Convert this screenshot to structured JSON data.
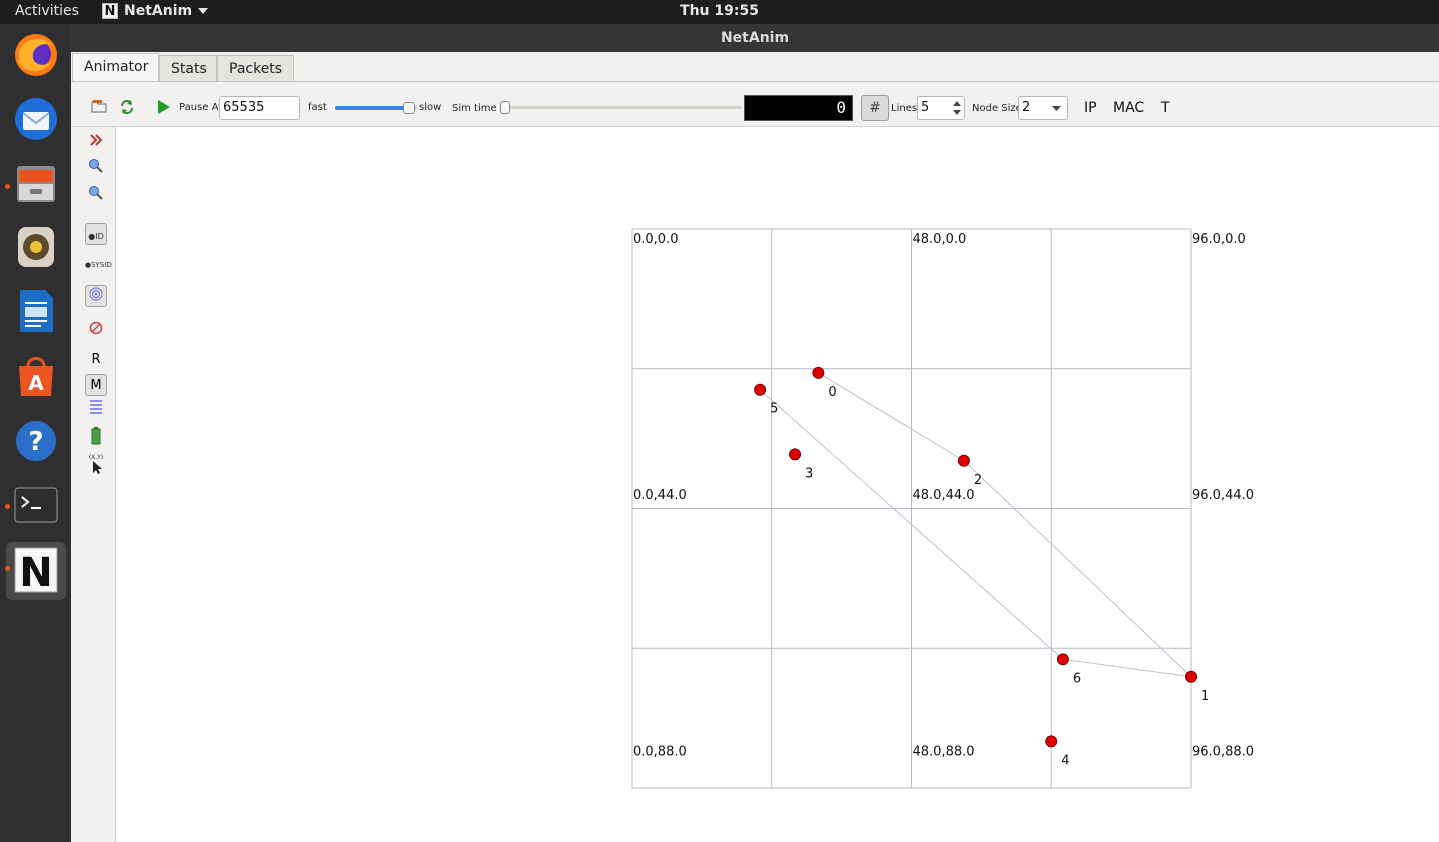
{
  "topbar": {
    "activities_label": "Activities",
    "app_menu_logo": "N",
    "app_menu_label": "NetAnim",
    "app_menu_icon": "chevron-down-icon",
    "clock": "Thu 19:55"
  },
  "dock": {
    "items": [
      {
        "name": "Firefox",
        "icon": "firefox-icon",
        "running": false
      },
      {
        "name": "Thunderbird",
        "icon": "thunderbird-icon",
        "running": false
      },
      {
        "name": "Files",
        "icon": "files-icon",
        "running": true
      },
      {
        "name": "Rhythmbox",
        "icon": "rhythmbox-icon",
        "running": false
      },
      {
        "name": "LibreOffice Writer",
        "icon": "writer-icon",
        "running": false
      },
      {
        "name": "Ubuntu Software",
        "icon": "software-icon",
        "running": false
      },
      {
        "name": "Help",
        "icon": "help-icon",
        "running": false
      },
      {
        "name": "Terminal",
        "icon": "terminal-icon",
        "running": true
      },
      {
        "name": "NetAnim",
        "icon": "netanim-icon",
        "running": true,
        "label": "N"
      }
    ]
  },
  "window": {
    "title": "NetAnim"
  },
  "tabs": [
    {
      "label": "Animator",
      "active": true
    },
    {
      "label": "Stats",
      "active": false
    },
    {
      "label": "Packets",
      "active": false
    }
  ],
  "toolbar": {
    "pause_at_label": "Pause At",
    "pause_at_value": "65535",
    "fast_label": "fast",
    "slow_label": "slow",
    "speed_fraction": 0.9,
    "sim_time_label": "Sim time",
    "sim_time_fraction": 0.0,
    "sim_time_display": "0",
    "grid_toggle_icon": "hash-icon",
    "lines_label": "Lines",
    "lines_value": "5",
    "node_size_label": "Node Size",
    "node_size_value": "2",
    "ip_label": "IP",
    "mac_label": "MAC",
    "t_label": "T",
    "accent": "#3584e4"
  },
  "side_tools": {
    "r_label": "R",
    "m_label": "M",
    "sysid_label": "SYSID",
    "id_label": "ID",
    "xy_label": "(X,Y)"
  },
  "topology": {
    "x_range": [
      0,
      96
    ],
    "y_range": [
      0,
      96
    ],
    "grid_lines": 5,
    "grid_labels": [
      {
        "text": "0.0,0.0",
        "x": 0,
        "y": 0
      },
      {
        "text": "48.0,0.0",
        "x": 48,
        "y": 0
      },
      {
        "text": "96.0,0.0",
        "x": 96,
        "y": 0
      },
      {
        "text": "0.0,44.0",
        "x": 0,
        "y": 44
      },
      {
        "text": "48.0,44.0",
        "x": 48,
        "y": 44
      },
      {
        "text": "96.0,44.0",
        "x": 96,
        "y": 44
      },
      {
        "text": "0.0,88.0",
        "x": 0,
        "y": 88
      },
      {
        "text": "48.0,88.0",
        "x": 48,
        "y": 88
      },
      {
        "text": "96.0,88.0",
        "x": 96,
        "y": 88
      }
    ],
    "nodes": [
      {
        "id": "0",
        "x": 32.0,
        "y": 24.7
      },
      {
        "id": "1",
        "x": 96.0,
        "y": 76.9
      },
      {
        "id": "2",
        "x": 57.0,
        "y": 39.8
      },
      {
        "id": "3",
        "x": 28.0,
        "y": 38.7
      },
      {
        "id": "4",
        "x": 72.0,
        "y": 88.0
      },
      {
        "id": "5",
        "x": 22.0,
        "y": 27.6
      },
      {
        "id": "6",
        "x": 74.0,
        "y": 73.9
      }
    ],
    "links": [
      [
        "0",
        "2"
      ],
      [
        "2",
        "1"
      ],
      [
        "5",
        "6"
      ],
      [
        "6",
        "1"
      ]
    ],
    "node_color": "#e00000"
  }
}
